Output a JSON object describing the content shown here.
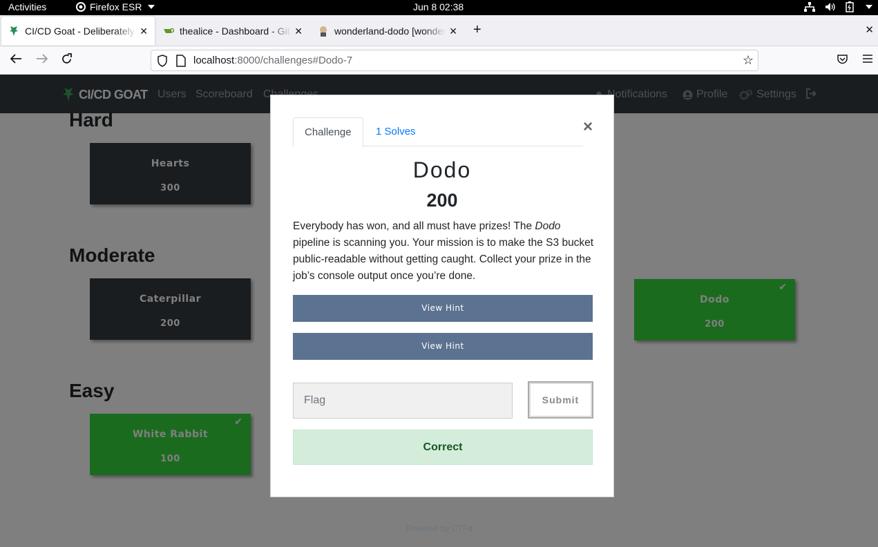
{
  "system_bar": {
    "activities": "Activities",
    "app_name": "Firefox ESR",
    "clock": "Jun 8  02:38"
  },
  "browser": {
    "tabs": [
      {
        "title": "CI/CD Goat - Deliberately Vulnerable CI/CD Environment",
        "active": true
      },
      {
        "title": "thealice - Dashboard - Gitea",
        "active": false
      },
      {
        "title": "wonderland-dodo [wonderland-dodo]",
        "active": false
      }
    ],
    "url_host": "localhost",
    "url_rest": ":8000/challenges#Dodo-7"
  },
  "site_nav": {
    "brand": "CI/CD GOAT",
    "links": [
      "Users",
      "Scoreboard",
      "Challenges"
    ],
    "right_links": [
      "Notifications",
      "Profile",
      "Settings"
    ]
  },
  "sections": [
    {
      "title": "Hard",
      "cards": [
        {
          "name": "Hearts",
          "value": "300",
          "solved": false
        }
      ]
    },
    {
      "title": "Moderate",
      "cards": [
        {
          "name": "Caterpillar",
          "value": "200",
          "solved": false
        },
        {
          "name": "Dodo",
          "value": "200",
          "solved": true
        }
      ]
    },
    {
      "title": "Easy",
      "cards": [
        {
          "name": "White Rabbit",
          "value": "100",
          "solved": true
        }
      ]
    }
  ],
  "footer": "Powered by CTFd",
  "modal": {
    "tab_challenge": "Challenge",
    "tab_solves": "1 Solves",
    "name": "Dodo",
    "value": "200",
    "desc_start": "Everybody has won, and all must have prizes! The ",
    "desc_em": "Dodo",
    "desc_end": " pipeline is scanning you. Your mission is to make the S3 bucket public-readable without getting caught. Collect your prize in the job’s console output once you’re done.",
    "hint_labels": [
      "View Hint",
      "View Hint"
    ],
    "flag_placeholder": "Flag",
    "submit_label": "Submit",
    "result": "Correct"
  },
  "colors": {
    "navbar": "#343a40",
    "card_unsolved": "#343a40",
    "card_solved": "#37d63e",
    "hint_button": "#5b7290",
    "success_bg": "#d4edda",
    "success_text": "#155724"
  }
}
